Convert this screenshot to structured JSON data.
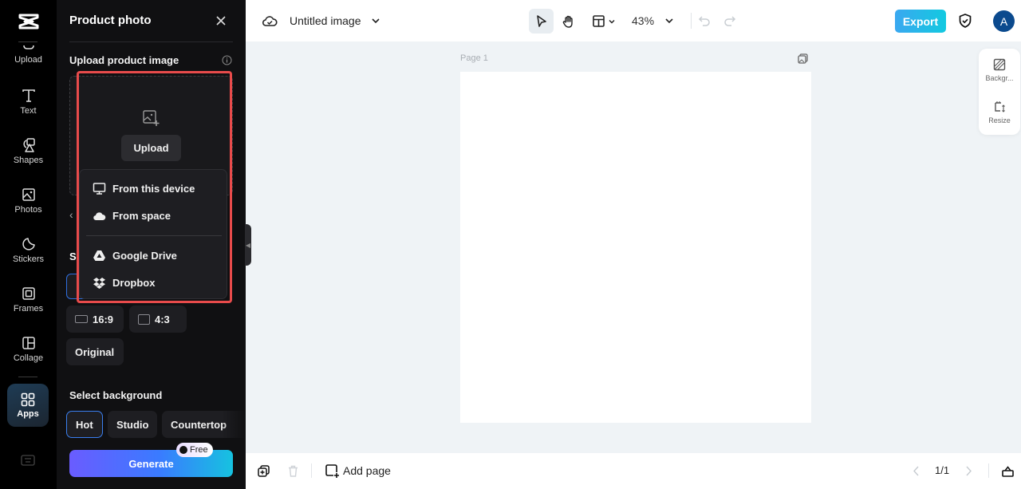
{
  "rail": {
    "items": [
      {
        "label": "Upload",
        "icon": "upload-icon"
      },
      {
        "label": "Text",
        "icon": "text-icon"
      },
      {
        "label": "Shapes",
        "icon": "shapes-icon"
      },
      {
        "label": "Photos",
        "icon": "photos-icon"
      },
      {
        "label": "Stickers",
        "icon": "stickers-icon"
      },
      {
        "label": "Frames",
        "icon": "frames-icon"
      },
      {
        "label": "Collage",
        "icon": "collage-icon"
      },
      {
        "label": "Apps",
        "icon": "apps-icon",
        "active": true
      }
    ]
  },
  "panel": {
    "title": "Product photo",
    "upload_section": "Upload product image",
    "upload_button": "Upload",
    "size_section_partial": "S",
    "ratios": [
      {
        "label": "16:9"
      },
      {
        "label": "4:3"
      },
      {
        "label": "Original"
      }
    ],
    "background_section": "Select background",
    "backgrounds": [
      {
        "label": "Hot",
        "selected": true
      },
      {
        "label": "Studio"
      },
      {
        "label": "Countertop"
      }
    ],
    "generate_label": "Generate",
    "free_badge": "Free"
  },
  "upload_menu": {
    "items": [
      {
        "label": "From this device",
        "icon": "monitor-icon"
      },
      {
        "label": "From space",
        "icon": "cloud-icon"
      },
      {
        "label": "Google Drive",
        "icon": "google-drive-icon"
      },
      {
        "label": "Dropbox",
        "icon": "dropbox-icon"
      }
    ]
  },
  "topbar": {
    "doc_title": "Untitled image",
    "zoom": "43%",
    "export_label": "Export",
    "avatar_initial": "A"
  },
  "canvas": {
    "page_label": "Page 1"
  },
  "right_tools": [
    {
      "label": "Backgr..."
    },
    {
      "label": "Resize"
    }
  ],
  "bottombar": {
    "add_page": "Add page",
    "page_count": "1/1"
  },
  "colors": {
    "accent_export": "#1fb8e8",
    "highlight": "#e84b4b",
    "selected_border": "#3a7ff0",
    "avatar": "#0b4a8e"
  }
}
